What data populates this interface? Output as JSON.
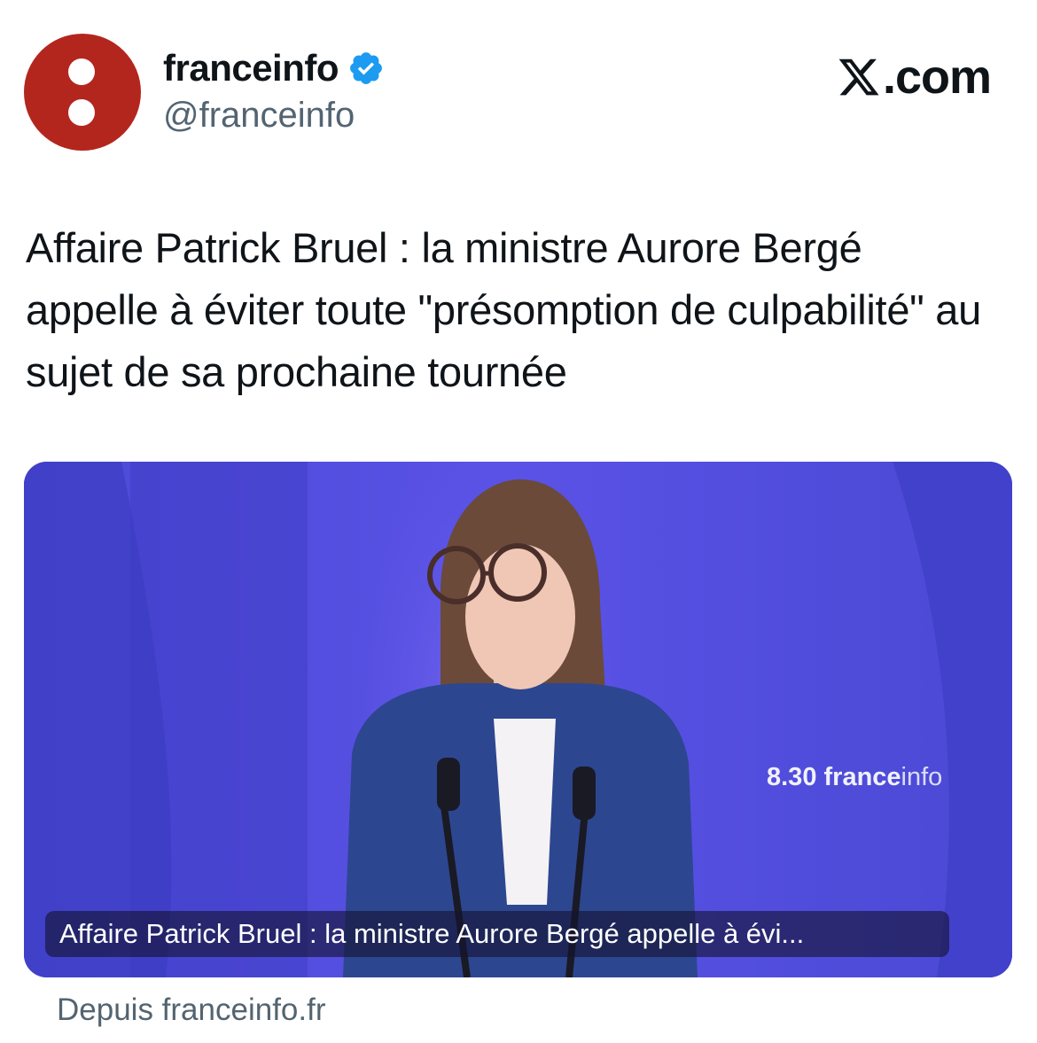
{
  "account": {
    "display_name": "franceinfo",
    "handle": "@franceinfo",
    "verified": true,
    "avatar_color": "#b3261e",
    "avatar_icon": "franceinfo-logo-icon"
  },
  "site_label": {
    "text": ".com",
    "icon": "x-logo-icon"
  },
  "tweet": {
    "text": "Affaire Patrick Bruel : la ministre Aurore Bergé appelle à éviter toute \"présomption de culpabilité\" au sujet de sa prochaine tournée"
  },
  "media": {
    "watermark_bold": "8.30 france",
    "watermark_light": "info",
    "caption": "Affaire Patrick Bruel : la ministre Aurore Bergé appelle à évi..."
  },
  "link_source": "Depuis franceinfo.fr",
  "colors": {
    "verified_blue": "#1d9bf0",
    "text_primary": "#0f1419",
    "text_secondary": "#536471",
    "studio_blue": "#4a48d8"
  }
}
